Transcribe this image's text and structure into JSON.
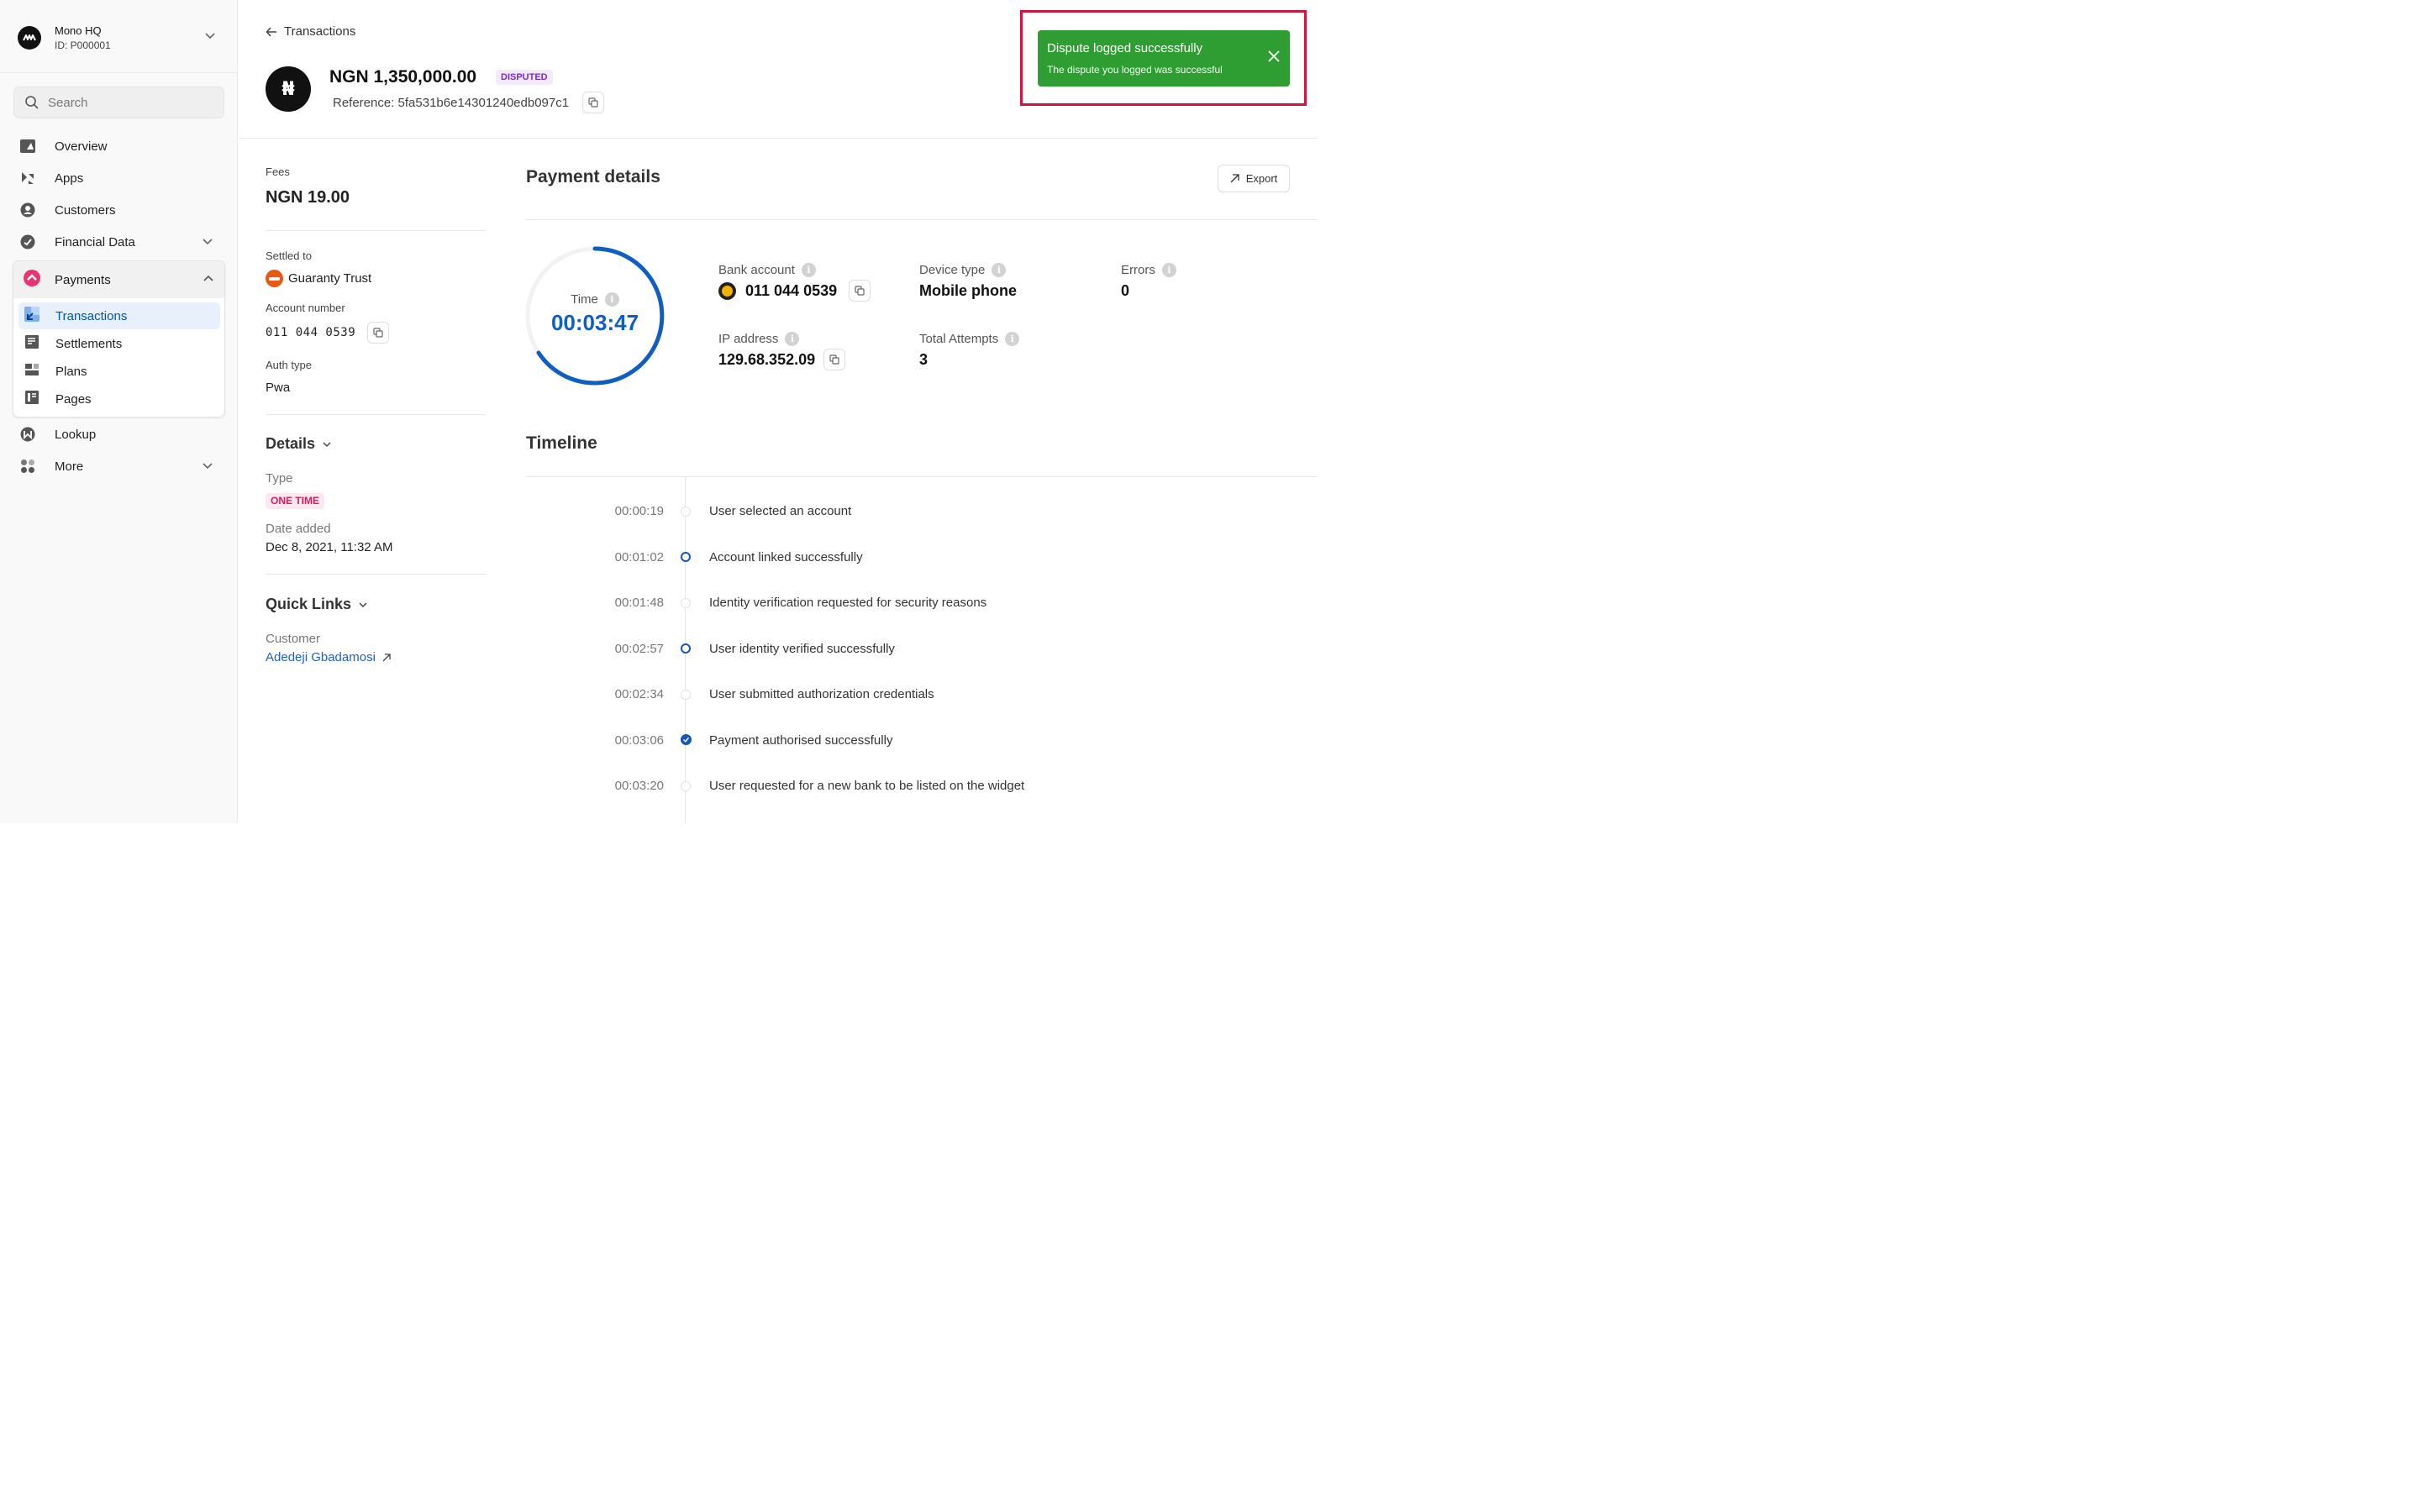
{
  "org": {
    "name": "Mono HQ",
    "id": "ID: P000001"
  },
  "search": {
    "placeholder": "Search"
  },
  "sidebar": {
    "items": [
      {
        "label": "Overview"
      },
      {
        "label": "Apps"
      },
      {
        "label": "Customers"
      },
      {
        "label": "Financial Data"
      },
      {
        "label": "Payments"
      },
      {
        "label": "Lookup"
      },
      {
        "label": "More"
      }
    ],
    "payments_sub": [
      {
        "label": "Transactions"
      },
      {
        "label": "Settlements"
      },
      {
        "label": "Plans"
      },
      {
        "label": "Pages"
      }
    ]
  },
  "header": {
    "back_label": "Transactions",
    "currency_symbol": "₦",
    "amount": "NGN 1,350,000.00",
    "status_badge": "DISPUTED",
    "reference": "Reference: 5fa531b6e14301240edb097c1"
  },
  "toast": {
    "title": "Dispute logged successfully",
    "message": "The dispute you logged was successful"
  },
  "info": {
    "fees_label": "Fees",
    "fees_value": "NGN 19.00",
    "settled_label": "Settled to",
    "settled_value": "Guaranty Trust",
    "account_number_label": "Account number",
    "account_number_value": "011 044 0539",
    "auth_type_label": "Auth type",
    "auth_type_value": "Pwa",
    "details_heading": "Details",
    "type_label": "Type",
    "type_value": "ONE TIME",
    "date_label": "Date added",
    "date_value": "Dec 8, 2021, 11:32 AM",
    "quick_links_heading": "Quick Links",
    "customer_label": "Customer",
    "customer_value": "Adedeji Gbadamosi"
  },
  "payment_details": {
    "title": "Payment details",
    "export_label": "Export",
    "time_label": "Time",
    "time_value": "00:03:47",
    "bank_account_label": "Bank account",
    "bank_account_value": "011 044 0539",
    "ip_label": "IP address",
    "ip_value": "129.68.352.09",
    "device_label": "Device type",
    "device_value": "Mobile phone",
    "attempts_label": "Total Attempts",
    "attempts_value": "3",
    "errors_label": "Errors",
    "errors_value": "0"
  },
  "timeline": {
    "title": "Timeline",
    "events": [
      {
        "time": "00:00:19",
        "text": "User selected an account",
        "marker": "faint"
      },
      {
        "time": "00:01:02",
        "text": "Account linked successfully",
        "marker": "blue"
      },
      {
        "time": "00:01:48",
        "text": "Identity verification requested for security reasons",
        "marker": "faint"
      },
      {
        "time": "00:02:57",
        "text": "User identity verified successfully",
        "marker": "blue"
      },
      {
        "time": "00:02:34",
        "text": "User submitted authorization credentials",
        "marker": "faint"
      },
      {
        "time": "00:03:06",
        "text": "Payment authorised successfully",
        "marker": "check"
      },
      {
        "time": "00:03:20",
        "text": "User requested for a new bank to be listed on the widget",
        "marker": "faint"
      }
    ]
  },
  "colors": {
    "accent": "#0f5fc2",
    "toast_success": "#2e9e33",
    "toast_frame": "#d4143a",
    "disputed_badge": "#7a2bd1",
    "onetime_badge": "#d61c5c"
  }
}
